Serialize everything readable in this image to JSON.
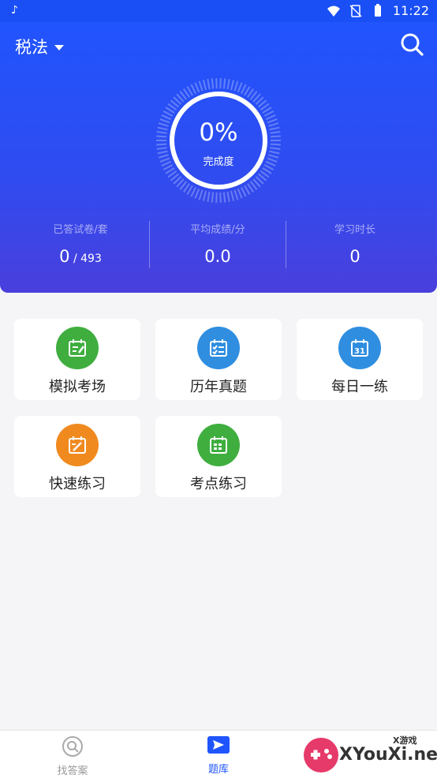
{
  "status_bar": {
    "time": "11:22",
    "app_glyph": "tiktok-icon"
  },
  "header": {
    "subject": "税法",
    "search_icon": "search-icon"
  },
  "progress": {
    "percent_text": "0%",
    "percent_value": 0,
    "label": "完成度"
  },
  "stats": [
    {
      "label": "已答试卷/套",
      "value": "0",
      "total": " / 493"
    },
    {
      "label": "平均成绩/分",
      "value": "0.0",
      "total": ""
    },
    {
      "label": "学习时长",
      "value": "0",
      "total": ""
    }
  ],
  "features": [
    {
      "label": "模拟考场",
      "icon": "exam-pencil-icon",
      "color": "#3fae3f"
    },
    {
      "label": "历年真题",
      "icon": "checklist-calendar-icon",
      "color": "#2f8ee0"
    },
    {
      "label": "每日一练",
      "icon": "calendar-31-icon",
      "color": "#2f8ee0"
    },
    {
      "label": "快速练习",
      "icon": "calendar-edit-icon",
      "color": "#f08a1f"
    },
    {
      "label": "考点练习",
      "icon": "calendar-grid-icon",
      "color": "#3fae3f"
    }
  ],
  "bottom_nav": [
    {
      "label": "找答案",
      "icon": "search-icon",
      "active": false
    },
    {
      "label": "题库",
      "icon": "send-icon",
      "active": true
    }
  ],
  "watermark": {
    "brand": "XYouXi.net",
    "tag": "X游戏"
  },
  "colors": {
    "accent": "#1f55ff",
    "active_nav": "#1f55ff",
    "inactive_nav": "#999999"
  }
}
